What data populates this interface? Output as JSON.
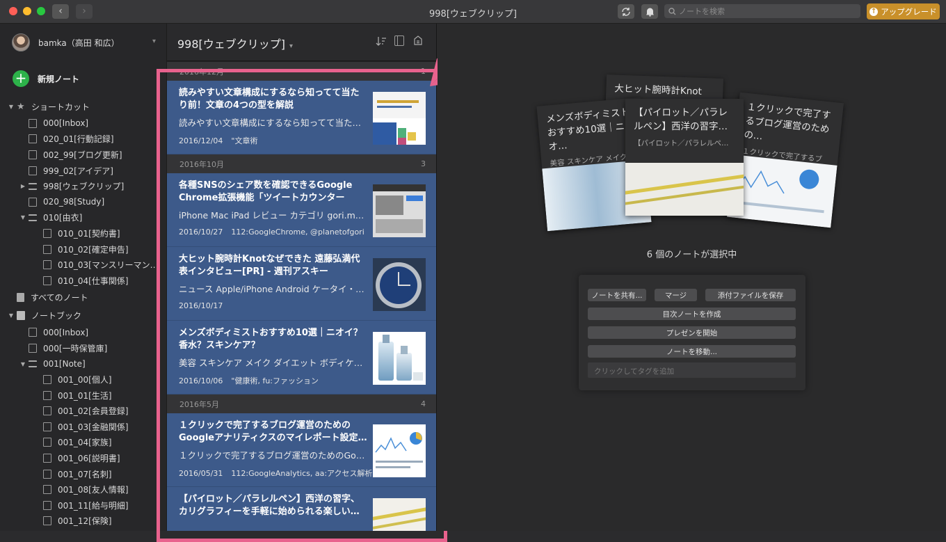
{
  "window": {
    "title": "998[ウェブクリップ]"
  },
  "toolbar": {
    "search_placeholder": "ノートを検索",
    "upgrade_label": "アップグレード"
  },
  "sidebar": {
    "user_name": "bamka（高田 和広）",
    "new_note_label": "新規ノート",
    "shortcuts_label": "ショートカット",
    "shortcuts": [
      "000[Inbox]",
      "020_01[行動記録]",
      "002_99[ブログ更新]",
      "999_02[アイデア]",
      "998[ウェブクリップ]",
      "020_98[Study]",
      "010[由衣]"
    ],
    "yui_children": [
      "010_01[契約書]",
      "010_02[確定申告]",
      "010_03[マンスリーマン…",
      "010_04[仕事関係]"
    ],
    "all_notes_label": "すべてのノート",
    "notebooks_label": "ノートブック",
    "notebooks": [
      "000[Inbox]",
      "000[一時保管庫]",
      "001[Note]"
    ],
    "note_children": [
      "001_00[個人]",
      "001_01[生活]",
      "001_02[会員登録]",
      "001_03[金融関係]",
      "001_04[家族]",
      "001_06[説明書]",
      "001_07[名刺]",
      "001_08[友人情報]",
      "001_11[給与明細]",
      "001_12[保険]"
    ]
  },
  "list": {
    "title": "998[ウェブクリップ]",
    "sections": [
      {
        "label": "2016年12月",
        "count": "1",
        "notes": [
          {
            "title": "読みやすい文章構成にするなら知ってて当たり前！文章の4つの型を解説",
            "snippet": "読みやすい文章構成にするなら知ってて当た…",
            "date": "2016/12/04",
            "tags": "\"文章術"
          }
        ]
      },
      {
        "label": "2016年10月",
        "count": "3",
        "notes": [
          {
            "title": "各種SNSのシェア数を確認できるGoogle Chrome拡張機能「ツイートカウンター for…",
            "snippet": "iPhone Mac iPad レビュー カテゴリ gori.me…",
            "date": "2016/10/27",
            "tags": "112:GoogleChrome, @planetofgori"
          },
          {
            "title": "大ヒット腕時計Knotなぜできた 遠藤弘満代表インタビュー[PR] - 週刊アスキー",
            "snippet": "ニュース Apple/iPhone Android ケータイ・…",
            "date": "2016/10/17",
            "tags": ""
          },
          {
            "title": "メンズボディミストおすすめ10選｜ニオイ？香水？スキンケア？",
            "snippet": "美容 スキンケア メイク ダイエット ボディケ…",
            "date": "2016/10/06",
            "tags": "\"健康術, fu:ファッション"
          }
        ]
      },
      {
        "label": "2016年5月",
        "count": "4",
        "notes": [
          {
            "title": "１クリックで完了するブログ運営のためのGoogleアナリティクスのマイレポート設定…",
            "snippet": "１クリックで完了するブログ運営のためのGoo…",
            "date": "2016/05/31",
            "tags": "112:GoogleAnalytics, aa:アクセス解析"
          },
          {
            "title": "【パイロット／パラレルペン】西洋の習字、カリグラフィーを手軽に始められる楽しい…",
            "snippet": "",
            "date": "",
            "tags": ""
          }
        ]
      }
    ]
  },
  "main": {
    "stack_cards": [
      {
        "title": "大ヒット腕時計Knot",
        "subtitle": ""
      },
      {
        "title": "メンズボディミストおすすめ10選｜ニオ…",
        "subtitle": "美容 スキンケア メイク…"
      },
      {
        "title": "【パイロット／パラレルペン】西洋の習字…",
        "subtitle": "【パイロット／パラレルペ…"
      },
      {
        "title": "１クリックで完了するブログ運営のための…",
        "subtitle": "１クリックで完了するブロ…"
      }
    ],
    "selection_text": "6 個のノートが選択中",
    "actions": {
      "share": "ノートを共有...",
      "merge": "マージ",
      "save_attachments": "添付ファイルを保存",
      "toc": "目次ノートを作成",
      "present": "プレゼンを開始",
      "move": "ノートを移動...",
      "tag_placeholder": "クリックしてタグを追加"
    }
  },
  "colors": {
    "accent_highlight": "#e8628d",
    "selected_card": "#3d5a8a",
    "new_note_green": "#2db24a",
    "upgrade": "#c9902a"
  }
}
